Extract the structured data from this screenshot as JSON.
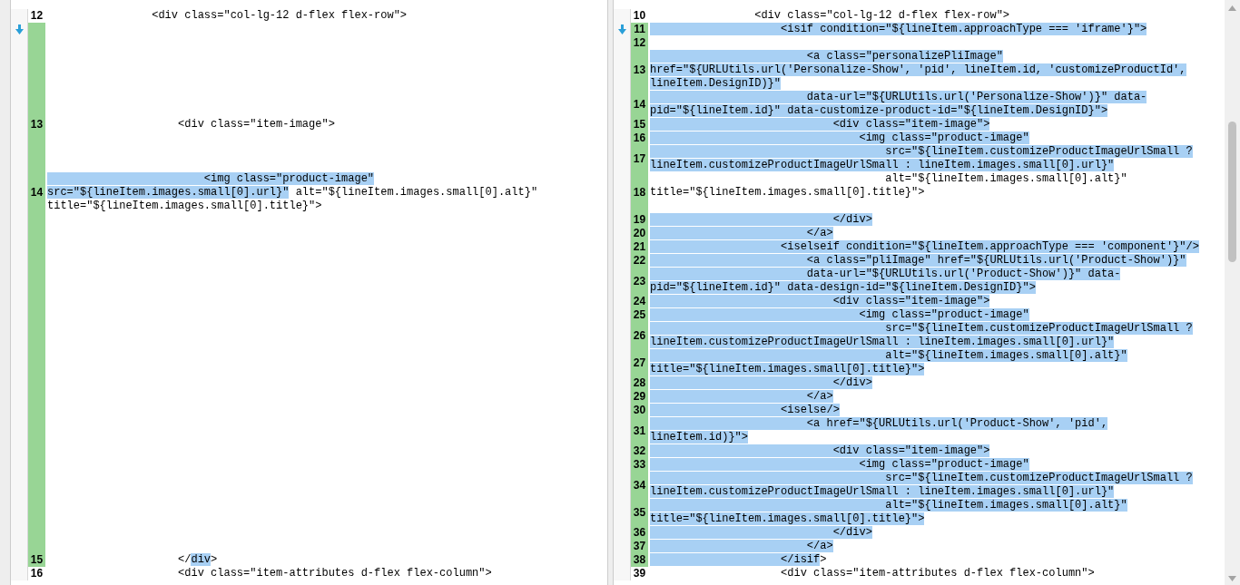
{
  "panes": [
    {
      "lines": [
        {
          "kind": "code",
          "num": "12",
          "changed": false,
          "rows": [
            {
              "kind": "code",
              "segments": [
                {
                  "text": "                <div class=\"col-lg-12 d-flex flex-row\">",
                  "selected": false
                }
              ]
            }
          ]
        },
        {
          "kind": "filler",
          "changed": true,
          "arrow": true
        },
        {
          "kind": "filler",
          "changed": true
        },
        {
          "kind": "filler",
          "changed": true
        },
        {
          "kind": "filler",
          "changed": true
        },
        {
          "kind": "filler",
          "changed": true
        },
        {
          "kind": "filler",
          "changed": true
        },
        {
          "kind": "filler",
          "changed": true
        },
        {
          "kind": "code",
          "num": "13",
          "changed": true,
          "rows": [
            {
              "kind": "code",
              "segments": [
                {
                  "text": "                    <div class=\"item-image\">",
                  "selected": false
                }
              ]
            }
          ]
        },
        {
          "kind": "filler",
          "changed": true
        },
        {
          "kind": "filler",
          "changed": true
        },
        {
          "kind": "filler",
          "changed": true
        },
        {
          "kind": "code",
          "num": "14",
          "changed": true,
          "rows": [
            {
              "kind": "code",
              "segments": [
                {
                  "text": "                        <img class=\"product-image\"",
                  "selected": true
                }
              ]
            },
            {
              "kind": "code",
              "segments": [
                {
                  "text": "src=\"${lineItem.images.small[0].url}\"",
                  "selected": true
                },
                {
                  "text": " alt=\"${lineItem.images.small[0].alt}\"",
                  "selected": false
                }
              ]
            },
            {
              "kind": "code",
              "segments": [
                {
                  "text": "title=\"${lineItem.images.small[0].title}\">",
                  "selected": false
                }
              ]
            }
          ]
        },
        {
          "kind": "filler",
          "changed": true
        },
        {
          "kind": "filler",
          "changed": true
        },
        {
          "kind": "filler",
          "changed": true
        },
        {
          "kind": "filler",
          "changed": true
        },
        {
          "kind": "filler",
          "changed": true
        },
        {
          "kind": "filler",
          "changed": true
        },
        {
          "kind": "filler",
          "changed": true
        },
        {
          "kind": "filler",
          "changed": true
        },
        {
          "kind": "filler",
          "changed": true
        },
        {
          "kind": "filler",
          "changed": true
        },
        {
          "kind": "filler",
          "changed": true
        },
        {
          "kind": "filler",
          "changed": true
        },
        {
          "kind": "filler",
          "changed": true
        },
        {
          "kind": "filler",
          "changed": true
        },
        {
          "kind": "filler",
          "changed": true
        },
        {
          "kind": "filler",
          "changed": true
        },
        {
          "kind": "filler",
          "changed": true
        },
        {
          "kind": "filler",
          "changed": true
        },
        {
          "kind": "filler",
          "changed": true
        },
        {
          "kind": "filler",
          "changed": true
        },
        {
          "kind": "filler",
          "changed": true
        },
        {
          "kind": "filler",
          "changed": true
        },
        {
          "kind": "filler",
          "changed": true
        },
        {
          "kind": "filler",
          "changed": true
        },
        {
          "kind": "filler",
          "changed": true
        },
        {
          "kind": "code",
          "num": "15",
          "changed": true,
          "rows": [
            {
              "kind": "code",
              "segments": [
                {
                  "text": "                    </",
                  "selected": false
                },
                {
                  "text": "div",
                  "selected": true
                },
                {
                  "text": ">",
                  "selected": false
                }
              ]
            }
          ]
        },
        {
          "kind": "code",
          "num": "16",
          "changed": false,
          "rows": [
            {
              "kind": "code",
              "segments": [
                {
                  "text": "                    <div class=\"item-attributes d-flex flex-column\">",
                  "selected": false
                }
              ]
            }
          ]
        }
      ]
    },
    {
      "lines": [
        {
          "kind": "code",
          "num": "10",
          "changed": false,
          "rows": [
            {
              "kind": "code",
              "segments": [
                {
                  "text": "                <div class=\"col-lg-12 d-flex flex-row\">",
                  "selected": false
                }
              ]
            }
          ]
        },
        {
          "kind": "code",
          "num": "11",
          "changed": true,
          "arrow": true,
          "rows": [
            {
              "kind": "code",
              "segments": [
                {
                  "text": "                    <isif condition=\"${lineItem.approachType === 'iframe'}\">",
                  "selected": true
                }
              ]
            }
          ]
        },
        {
          "kind": "code",
          "num": "12",
          "changed": true,
          "rows": [
            {
              "kind": "blank"
            }
          ]
        },
        {
          "kind": "code",
          "num": "13",
          "changed": true,
          "rows": [
            {
              "kind": "code",
              "segments": [
                {
                  "text": "                        <a class=\"personalizePliImage\"",
                  "selected": true
                }
              ]
            },
            {
              "kind": "code",
              "segments": [
                {
                  "text": "href=\"${URLUtils.url('Personalize-Show', 'pid', lineItem.id, 'customizeProductId',",
                  "selected": true
                }
              ]
            },
            {
              "kind": "code",
              "segments": [
                {
                  "text": "lineItem.DesignID)}\"",
                  "selected": true
                }
              ]
            }
          ]
        },
        {
          "kind": "code",
          "num": "14",
          "changed": true,
          "rows": [
            {
              "kind": "code",
              "segments": [
                {
                  "text": "                        data-url=\"${URLUtils.url('Personalize-Show')}\" data-",
                  "selected": true
                }
              ]
            },
            {
              "kind": "code",
              "segments": [
                {
                  "text": "pid=\"${lineItem.id}\" data-customize-product-id=\"${lineItem.DesignID}\">",
                  "selected": true
                }
              ]
            }
          ]
        },
        {
          "kind": "code",
          "num": "15",
          "changed": true,
          "rows": [
            {
              "kind": "code",
              "segments": [
                {
                  "text": "                            <div class=\"item-image\">",
                  "selected": true
                }
              ]
            }
          ]
        },
        {
          "kind": "code",
          "num": "16",
          "changed": true,
          "rows": [
            {
              "kind": "code",
              "segments": [
                {
                  "text": "                                <img class=\"product-image\"",
                  "selected": true
                }
              ]
            }
          ]
        },
        {
          "kind": "code",
          "num": "17",
          "changed": true,
          "rows": [
            {
              "kind": "code",
              "segments": [
                {
                  "text": "                                    src=\"${lineItem.customizeProductImageUrlSmall ?",
                  "selected": true
                }
              ]
            },
            {
              "kind": "code",
              "segments": [
                {
                  "text": "lineItem.customizeProductImageUrlSmall : lineItem.images.small[0].url}\"",
                  "selected": true
                }
              ]
            }
          ]
        },
        {
          "kind": "code",
          "num": "18",
          "changed": true,
          "rows": [
            {
              "kind": "code",
              "segments": [
                {
                  "text": "                                    alt=\"${lineItem.images.small[0].alt}\"",
                  "selected": false
                }
              ]
            },
            {
              "kind": "code",
              "segments": [
                {
                  "text": "title=\"${lineItem.images.small[0].title}\">",
                  "selected": false
                }
              ]
            },
            {
              "kind": "blank"
            }
          ]
        },
        {
          "kind": "code",
          "num": "19",
          "changed": true,
          "rows": [
            {
              "kind": "code",
              "segments": [
                {
                  "text": "                            </div>",
                  "selected": true
                }
              ]
            }
          ]
        },
        {
          "kind": "code",
          "num": "20",
          "changed": true,
          "rows": [
            {
              "kind": "code",
              "segments": [
                {
                  "text": "                        </a>",
                  "selected": true
                }
              ]
            }
          ]
        },
        {
          "kind": "code",
          "num": "21",
          "changed": true,
          "rows": [
            {
              "kind": "code",
              "segments": [
                {
                  "text": "                    <iselseif condition=\"${lineItem.approachType === 'component'}\"/>",
                  "selected": true
                }
              ]
            }
          ]
        },
        {
          "kind": "code",
          "num": "22",
          "changed": true,
          "rows": [
            {
              "kind": "code",
              "segments": [
                {
                  "text": "                        <a class=\"pliImage\" href=\"${URLUtils.url('Product-Show')}\"",
                  "selected": true
                }
              ]
            }
          ]
        },
        {
          "kind": "code",
          "num": "23",
          "changed": true,
          "rows": [
            {
              "kind": "code",
              "segments": [
                {
                  "text": "                        data-url=\"${URLUtils.url('Product-Show')}\" data-",
                  "selected": true
                }
              ]
            },
            {
              "kind": "code",
              "segments": [
                {
                  "text": "pid=\"${lineItem.id}\" data-design-id=\"${lineItem.DesignID}\">",
                  "selected": true
                }
              ]
            }
          ]
        },
        {
          "kind": "code",
          "num": "24",
          "changed": true,
          "rows": [
            {
              "kind": "code",
              "segments": [
                {
                  "text": "                            <div class=\"item-image\">",
                  "selected": true
                }
              ]
            }
          ]
        },
        {
          "kind": "code",
          "num": "25",
          "changed": true,
          "rows": [
            {
              "kind": "code",
              "segments": [
                {
                  "text": "                                <img class=\"product-image\"",
                  "selected": true
                }
              ]
            }
          ]
        },
        {
          "kind": "code",
          "num": "26",
          "changed": true,
          "rows": [
            {
              "kind": "code",
              "segments": [
                {
                  "text": "                                    src=\"${lineItem.customizeProductImageUrlSmall ?",
                  "selected": true
                }
              ]
            },
            {
              "kind": "code",
              "segments": [
                {
                  "text": "lineItem.customizeProductImageUrlSmall : lineItem.images.small[0].url}\"",
                  "selected": true
                }
              ]
            }
          ]
        },
        {
          "kind": "code",
          "num": "27",
          "changed": true,
          "rows": [
            {
              "kind": "code",
              "segments": [
                {
                  "text": "                                    alt=\"${lineItem.images.small[0].alt}\"",
                  "selected": true
                }
              ]
            },
            {
              "kind": "code",
              "segments": [
                {
                  "text": "title=\"${lineItem.images.small[0].title}\">",
                  "selected": true
                }
              ]
            }
          ]
        },
        {
          "kind": "code",
          "num": "28",
          "changed": true,
          "rows": [
            {
              "kind": "code",
              "segments": [
                {
                  "text": "                            </div>",
                  "selected": true
                }
              ]
            }
          ]
        },
        {
          "kind": "code",
          "num": "29",
          "changed": true,
          "rows": [
            {
              "kind": "code",
              "segments": [
                {
                  "text": "                        </a>",
                  "selected": true
                }
              ]
            }
          ]
        },
        {
          "kind": "code",
          "num": "30",
          "changed": true,
          "rows": [
            {
              "kind": "code",
              "segments": [
                {
                  "text": "                    <iselse/>",
                  "selected": true
                }
              ]
            }
          ]
        },
        {
          "kind": "code",
          "num": "31",
          "changed": true,
          "rows": [
            {
              "kind": "code",
              "segments": [
                {
                  "text": "                        <a href=\"${URLUtils.url('Product-Show', 'pid',",
                  "selected": true
                }
              ]
            },
            {
              "kind": "code",
              "segments": [
                {
                  "text": "lineItem.id)}\">",
                  "selected": true
                }
              ]
            }
          ]
        },
        {
          "kind": "code",
          "num": "32",
          "changed": true,
          "rows": [
            {
              "kind": "code",
              "segments": [
                {
                  "text": "                            <div class=\"item-image\">",
                  "selected": true
                }
              ]
            }
          ]
        },
        {
          "kind": "code",
          "num": "33",
          "changed": true,
          "rows": [
            {
              "kind": "code",
              "segments": [
                {
                  "text": "                                <img class=\"product-image\"",
                  "selected": true
                }
              ]
            }
          ]
        },
        {
          "kind": "code",
          "num": "34",
          "changed": true,
          "rows": [
            {
              "kind": "code",
              "segments": [
                {
                  "text": "                                    src=\"${lineItem.customizeProductImageUrlSmall ?",
                  "selected": true
                }
              ]
            },
            {
              "kind": "code",
              "segments": [
                {
                  "text": "lineItem.customizeProductImageUrlSmall : lineItem.images.small[0].url}\"",
                  "selected": true
                }
              ]
            }
          ]
        },
        {
          "kind": "code",
          "num": "35",
          "changed": true,
          "rows": [
            {
              "kind": "code",
              "segments": [
                {
                  "text": "                                    alt=\"${lineItem.images.small[0].alt}\"",
                  "selected": true
                }
              ]
            },
            {
              "kind": "code",
              "segments": [
                {
                  "text": "title=\"${lineItem.images.small[0].title}\">",
                  "selected": true
                }
              ]
            }
          ]
        },
        {
          "kind": "code",
          "num": "36",
          "changed": true,
          "rows": [
            {
              "kind": "code",
              "segments": [
                {
                  "text": "                            </div>",
                  "selected": true
                }
              ]
            }
          ]
        },
        {
          "kind": "code",
          "num": "37",
          "changed": true,
          "rows": [
            {
              "kind": "code",
              "segments": [
                {
                  "text": "                        </a>",
                  "selected": true
                }
              ]
            }
          ]
        },
        {
          "kind": "code",
          "num": "38",
          "changed": true,
          "rows": [
            {
              "kind": "code",
              "segments": [
                {
                  "text": "                    </isif",
                  "selected": true
                },
                {
                  "text": ">",
                  "selected": false
                }
              ]
            }
          ]
        },
        {
          "kind": "code",
          "num": "39",
          "changed": false,
          "rows": [
            {
              "kind": "code",
              "segments": [
                {
                  "text": "                    <div class=\"item-attributes d-flex flex-column\">",
                  "selected": false
                }
              ]
            }
          ]
        }
      ]
    }
  ]
}
